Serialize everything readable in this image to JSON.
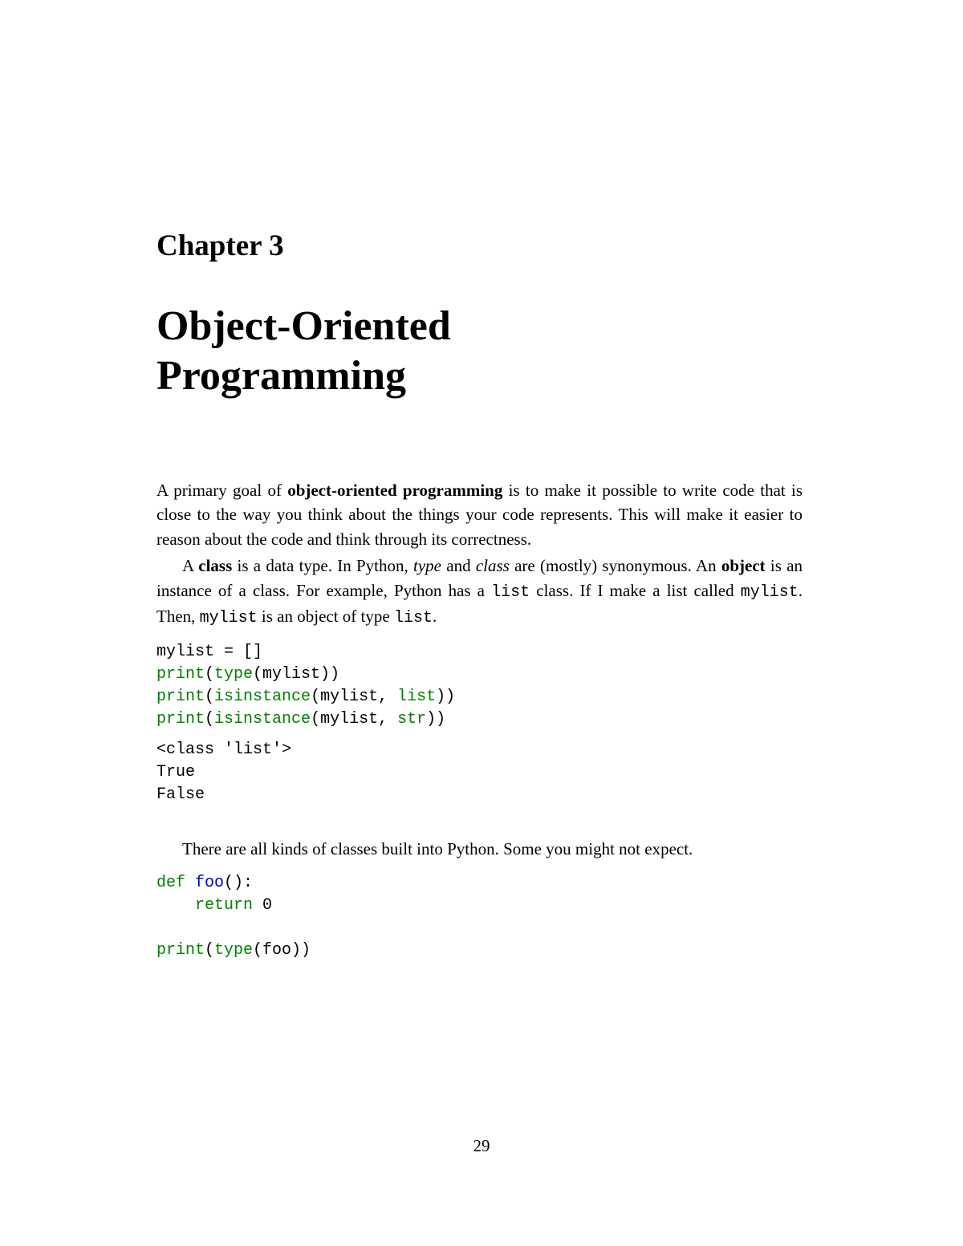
{
  "chapter": {
    "label": "Chapter 3",
    "title_line1": "Object-Oriented",
    "title_line2": "Programming"
  },
  "para1": {
    "t1": "A primary goal of ",
    "bold1": "object-oriented programming",
    "t2": " is to make it possible to write code that is close to the way you think about the things your code represents.  This will make it easier to reason about the code and think through its correctness."
  },
  "para2": {
    "t1": "A ",
    "bold1": "class",
    "t2": " is a data type. In Python, ",
    "it1": "type",
    "t3": " and ",
    "it2": "class",
    "t4": " are (mostly) synonymous.  An ",
    "bold2": "object",
    "t5": " is an instance of a class.  For example, Python has a ",
    "mono1": "list",
    "t6": " class. If I make a list called ",
    "mono2": "mylist",
    "t7": ". Then, ",
    "mono3": "mylist",
    "t8": " is an object of type ",
    "mono4": "list",
    "t9": "."
  },
  "code1": {
    "l1a": "mylist = []",
    "l2a": "print",
    "l2b": "(",
    "l2c": "type",
    "l2d": "(mylist))",
    "l3a": "print",
    "l3b": "(",
    "l3c": "isinstance",
    "l3d": "(mylist, ",
    "l3e": "list",
    "l3f": "))",
    "l4a": "print",
    "l4b": "(",
    "l4c": "isinstance",
    "l4d": "(mylist, ",
    "l4e": "str",
    "l4f": "))"
  },
  "output1": {
    "l1": "<class 'list'>",
    "l2": "True",
    "l3": "False"
  },
  "para3": {
    "t1": "There are all kinds of classes built into Python.  Some you might not expect."
  },
  "code2": {
    "l1a": "def",
    "l1b": " ",
    "l1c": "foo",
    "l1d": "():",
    "l2a": "    ",
    "l2b": "return",
    "l2c": " 0",
    "l3a": "print",
    "l3b": "(",
    "l3c": "type",
    "l3d": "(foo))"
  },
  "page_number": "29"
}
